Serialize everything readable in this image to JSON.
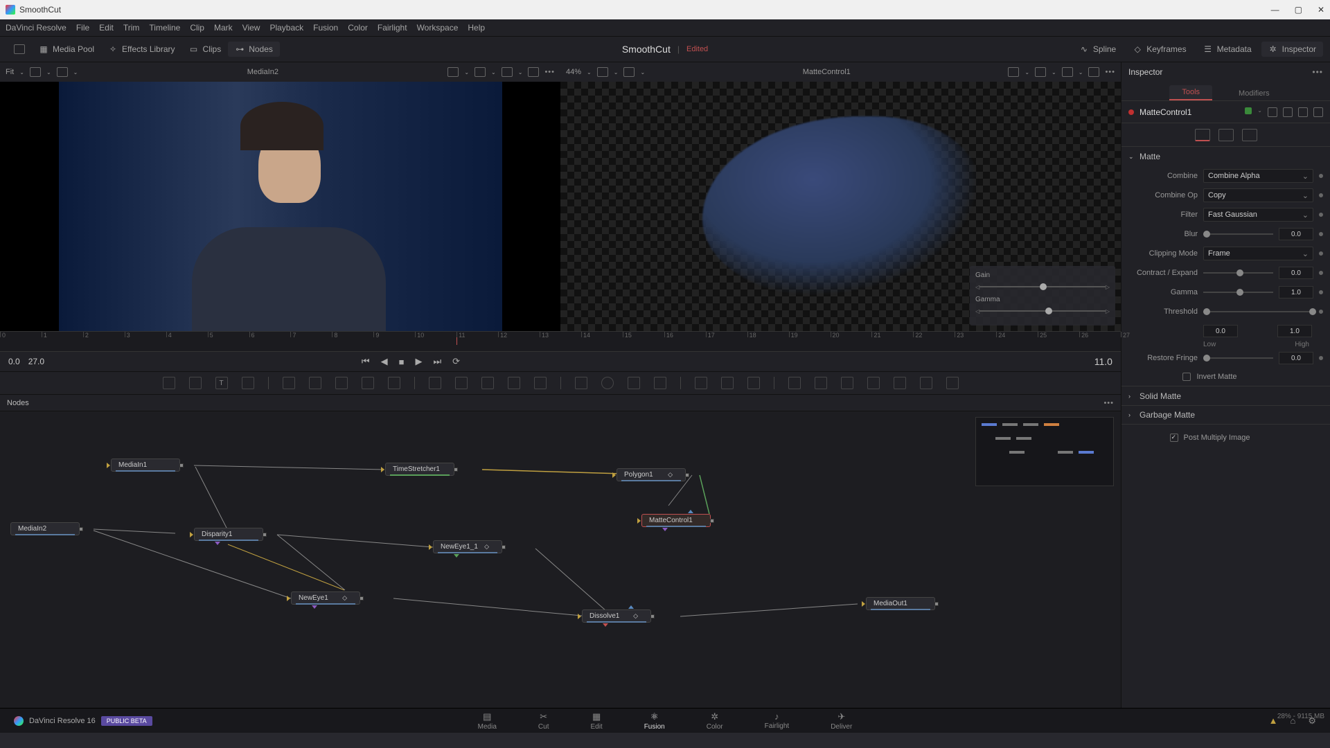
{
  "titlebar": {
    "title": "SmoothCut"
  },
  "menubar": [
    "DaVinci Resolve",
    "File",
    "Edit",
    "Trim",
    "Timeline",
    "Clip",
    "Mark",
    "View",
    "Playback",
    "Fusion",
    "Color",
    "Fairlight",
    "Workspace",
    "Help"
  ],
  "toolbar": {
    "media_pool": "Media Pool",
    "effects": "Effects Library",
    "clips": "Clips",
    "nodes": "Nodes",
    "spline": "Spline",
    "keyframes": "Keyframes",
    "metadata": "Metadata",
    "inspector": "Inspector",
    "project": "SmoothCut",
    "edited": "Edited"
  },
  "viewers": {
    "left": {
      "fit": "Fit",
      "name": "MediaIn2"
    },
    "right": {
      "zoom": "44%",
      "name": "MatteControl1",
      "gain": "Gain",
      "gamma": "Gamma"
    }
  },
  "ruler": {
    "ticks": [
      "0",
      "1",
      "2",
      "3",
      "4",
      "5",
      "6",
      "7",
      "8",
      "9",
      "10",
      "11",
      "12",
      "13",
      "14",
      "15",
      "16",
      "17",
      "18",
      "19",
      "20",
      "21",
      "22",
      "23",
      "24",
      "25",
      "26",
      "27"
    ],
    "playhead": 11
  },
  "transport": {
    "start": "0.0",
    "end": "27.0",
    "current": "11.0"
  },
  "nodes_panel": {
    "title": "Nodes"
  },
  "graph_nodes": {
    "mediain1": "MediaIn1",
    "mediain2": "MediaIn2",
    "timestretcher": "TimeStretcher1",
    "polygon": "Polygon1",
    "mattecontrol": "MatteControl1",
    "disparity": "Disparity1",
    "neweye11": "NewEye1_1",
    "neweye1": "NewEye1",
    "dissolve": "Dissolve1",
    "mediaout": "MediaOut1"
  },
  "inspector": {
    "title": "Inspector",
    "tabs": {
      "tools": "Tools",
      "modifiers": "Modifiers"
    },
    "node_name": "MatteControl1",
    "section_matte": "Matte",
    "combine": {
      "label": "Combine",
      "value": "Combine Alpha"
    },
    "combine_op": {
      "label": "Combine Op",
      "value": "Copy"
    },
    "filter": {
      "label": "Filter",
      "value": "Fast Gaussian"
    },
    "blur": {
      "label": "Blur",
      "value": "0.0"
    },
    "clipping": {
      "label": "Clipping Mode",
      "value": "Frame"
    },
    "contract": {
      "label": "Contract / Expand",
      "value": "0.0"
    },
    "gamma": {
      "label": "Gamma",
      "value": "1.0"
    },
    "threshold": {
      "label": "Threshold",
      "low": "0.0",
      "high": "1.0",
      "low_lbl": "Low",
      "high_lbl": "High"
    },
    "restore": {
      "label": "Restore Fringe",
      "value": "0.0"
    },
    "invert": "Invert Matte",
    "solid": "Solid Matte",
    "garbage": "Garbage Matte",
    "pmi": "Post Multiply Image"
  },
  "pages": {
    "brand": "DaVinci Resolve 16",
    "badge": "PUBLIC BETA",
    "media": "Media",
    "cut": "Cut",
    "edit": "Edit",
    "fusion": "Fusion",
    "color": "Color",
    "fairlight": "Fairlight",
    "deliver": "Deliver"
  },
  "status": "28% - 9115 MB"
}
